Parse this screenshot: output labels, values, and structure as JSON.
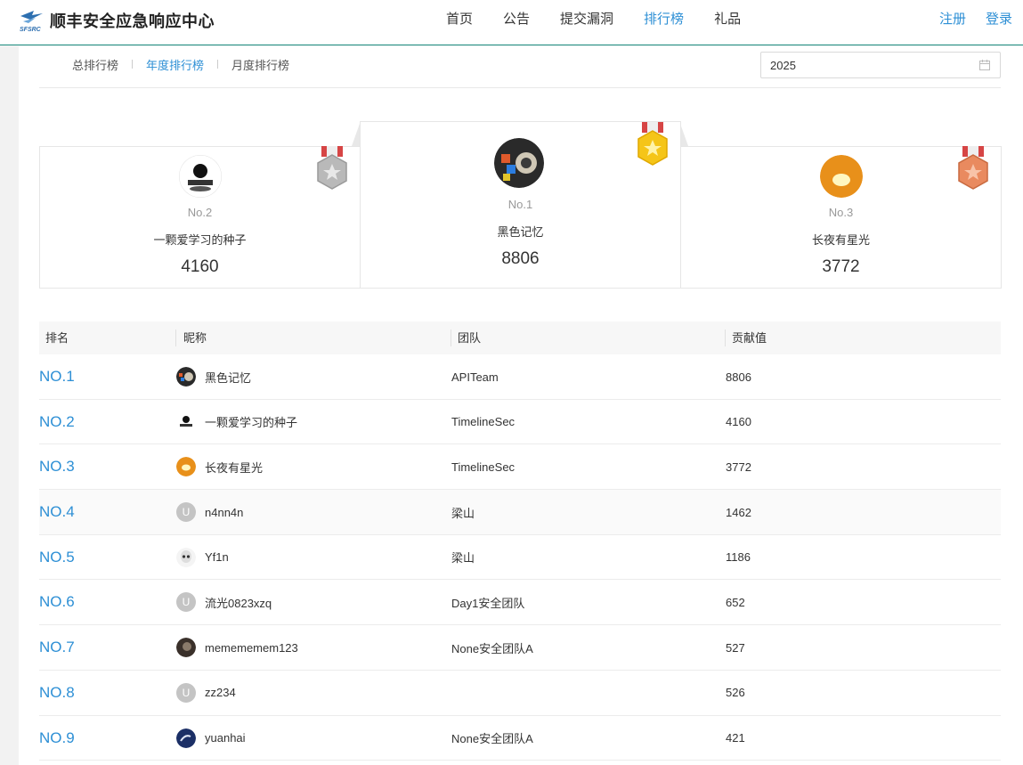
{
  "header": {
    "title": "顺丰安全应急响应中心",
    "logo_text": "SFSRC",
    "nav": [
      "首页",
      "公告",
      "提交漏洞",
      "排行榜",
      "礼品"
    ],
    "nav_active": "排行榜",
    "register": "注册",
    "login": "登录"
  },
  "subtabs": {
    "total": "总排行榜",
    "yearly": "年度排行榜",
    "monthly": "月度排行榜",
    "active": "年度排行榜"
  },
  "year_picker": {
    "value": "2025",
    "icon": "calendar-icon"
  },
  "podium": {
    "first": {
      "rank": "No.1",
      "name": "黑色记忆",
      "score": "8806",
      "medal": "gold-medal-icon"
    },
    "second": {
      "rank": "No.2",
      "name": "一颗爱学习的种子",
      "score": "4160",
      "medal": "silver-medal-icon"
    },
    "third": {
      "rank": "No.3",
      "name": "长夜有星光",
      "score": "3772",
      "medal": "bronze-medal-icon"
    }
  },
  "table": {
    "headers": {
      "rank": "排名",
      "nickname": "昵称",
      "team": "团队",
      "score": "贡献值"
    },
    "rows": [
      {
        "rank": "NO.1",
        "nickname": "黑色记忆",
        "team": "APITeam",
        "score": "8806",
        "avatar": "colorful"
      },
      {
        "rank": "NO.2",
        "nickname": "一颗爱学习的种子",
        "team": "TimelineSec",
        "score": "4160",
        "avatar": "cartoon"
      },
      {
        "rank": "NO.3",
        "nickname": "长夜有星光",
        "team": "TimelineSec",
        "score": "3772",
        "avatar": "orange"
      },
      {
        "rank": "NO.4",
        "nickname": "n4nn4n",
        "team": "梁山",
        "score": "1462",
        "avatar": "U"
      },
      {
        "rank": "NO.5",
        "nickname": "Yf1n",
        "team": "梁山",
        "score": "1186",
        "avatar": "skull"
      },
      {
        "rank": "NO.6",
        "nickname": "流光0823xzq",
        "team": "Day1安全团队",
        "score": "652",
        "avatar": "U"
      },
      {
        "rank": "NO.7",
        "nickname": "memememem123",
        "team": "None安全团队A",
        "score": "527",
        "avatar": "dark"
      },
      {
        "rank": "NO.8",
        "nickname": "zz234",
        "team": "",
        "score": "526",
        "avatar": "U"
      },
      {
        "rank": "NO.9",
        "nickname": "yuanhai",
        "team": "None安全团队A",
        "score": "421",
        "avatar": "navy"
      }
    ]
  },
  "colors": {
    "accent": "#2d8fd5",
    "header_border": "#1a8a7d",
    "gold": "#f5c518",
    "silver": "#b9b9b9",
    "bronze": "#e98a5f"
  }
}
